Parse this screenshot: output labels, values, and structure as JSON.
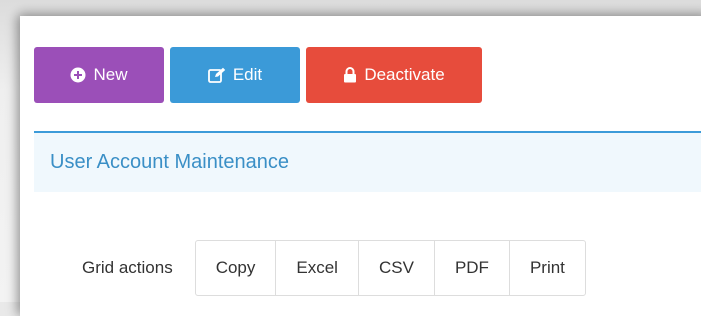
{
  "toolbar": {
    "new_label": "New",
    "edit_label": "Edit",
    "deactivate_label": "Deactivate",
    "colors": {
      "new": "#9b4fb8",
      "edit": "#3b9ad8",
      "deactivate": "#e74c3c"
    },
    "icons": {
      "new": "plus-circle-icon",
      "edit": "edit-icon",
      "deactivate": "lock-icon"
    }
  },
  "box": {
    "title": "User Account Maintenance",
    "accent_color": "#3a8fc6"
  },
  "grid_actions": {
    "label": "Grid actions",
    "buttons": [
      "Copy",
      "Excel",
      "CSV",
      "PDF",
      "Print"
    ]
  }
}
